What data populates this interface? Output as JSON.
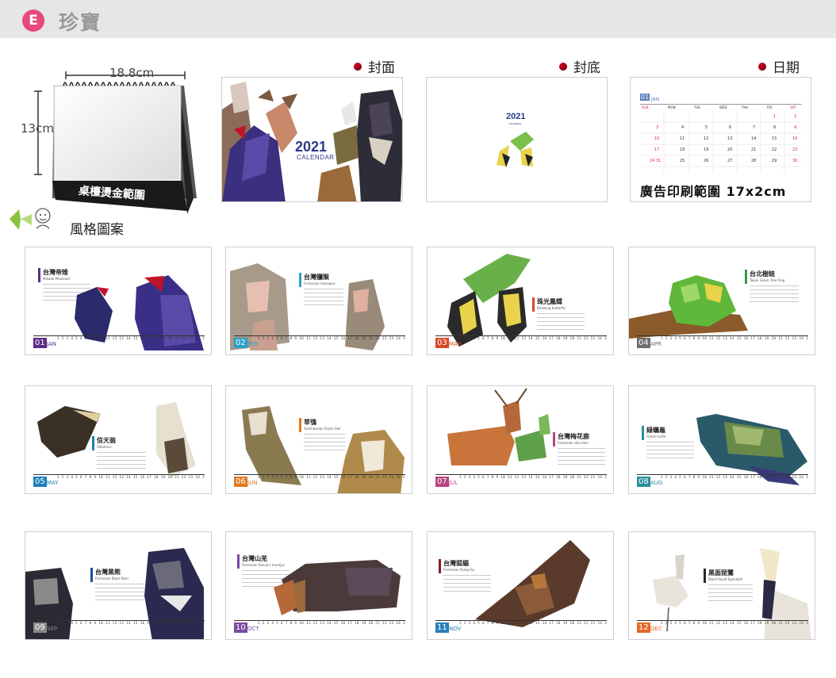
{
  "header": {
    "badge": "E",
    "title": "珍寶"
  },
  "sections": {
    "cover": "封面",
    "back": "封底",
    "dates": "日期",
    "style": "風格圖案"
  },
  "product": {
    "width": "18.8cm",
    "height": "13cm",
    "stand_label": "桌檯燙金範圍"
  },
  "cover": {
    "year": "2021",
    "subtitle": "CALENDAR"
  },
  "back": {
    "year": "2021",
    "subtitle": "CALENDAR"
  },
  "date_sample": {
    "month_num": "01",
    "month": "JAN",
    "weekdays": [
      "SUN",
      "MON",
      "TUE",
      "WED",
      "THU",
      "FRI",
      "SAT"
    ],
    "ad_text": "廣告印刷範圍 17x2cm"
  },
  "months": [
    {
      "num": "01",
      "mon": "JAN",
      "name": "台灣帝雉",
      "en": "Mikado Pheasant",
      "color": "#5a2d82"
    },
    {
      "num": "02",
      "mon": "FEB",
      "name": "台灣獼猴",
      "en": "Formosan macaque",
      "color": "#2a9fc9"
    },
    {
      "num": "03",
      "mon": "MAR",
      "name": "珠光鳳蝶",
      "en": "Birdwing butterfly",
      "color": "#d64a27"
    },
    {
      "num": "04",
      "mon": "APR",
      "name": "台北樹蛙",
      "en": "Taipei Green Tree Frog",
      "color": "#6d6d6d"
    },
    {
      "num": "05",
      "mon": "MAY",
      "name": "信天翁",
      "en": "Albatross",
      "color": "#1d7fb7"
    },
    {
      "num": "06",
      "mon": "JUN",
      "name": "草鴞",
      "en": "Australasian Grass Owl",
      "color": "#e07a20"
    },
    {
      "num": "07",
      "mon": "JUL",
      "name": "台灣梅花鹿",
      "en": "Formosan sika deer",
      "color": "#b64580"
    },
    {
      "num": "08",
      "mon": "AUG",
      "name": "綠蠵龜",
      "en": "Green turtle",
      "color": "#2a8f9c"
    },
    {
      "num": "09",
      "mon": "SEP",
      "name": "台灣黑熊",
      "en": "Formosan Black Bear",
      "color": "#8a8a8a"
    },
    {
      "num": "10",
      "mon": "OCT",
      "name": "台灣山羌",
      "en": "Formosan Reeve's muntjac",
      "color": "#7b4aa0"
    },
    {
      "num": "11",
      "mon": "NOV",
      "name": "台灣狐蝠",
      "en": "Formosan flying fox",
      "color": "#2c7fb8"
    },
    {
      "num": "12",
      "mon": "DEC",
      "name": "黑面琵鷺",
      "en": "Black-faced Spoonbill",
      "color": "#e4692b"
    }
  ],
  "colors": {
    "accent": "#e8487a",
    "red_dot": "#c1001c",
    "sunday": "#d8263c"
  }
}
